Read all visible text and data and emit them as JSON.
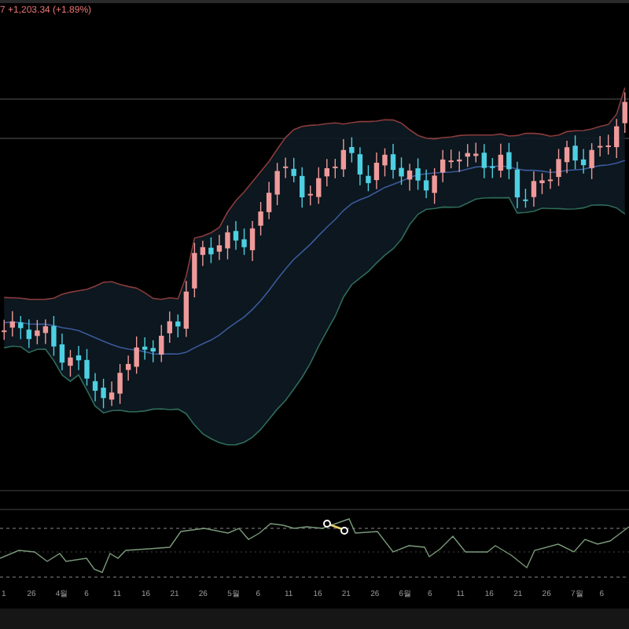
{
  "legend": {
    "change": "7 +1,203.34 (+1.89%)"
  },
  "time_axis": {
    "labels": [
      "1",
      "26",
      "4월",
      "6",
      "11",
      "16",
      "21",
      "26",
      "5월",
      "6",
      "11",
      "16",
      "21",
      "26",
      "6월",
      "6",
      "11",
      "16",
      "21",
      "26",
      "7월",
      "6"
    ]
  }
}
